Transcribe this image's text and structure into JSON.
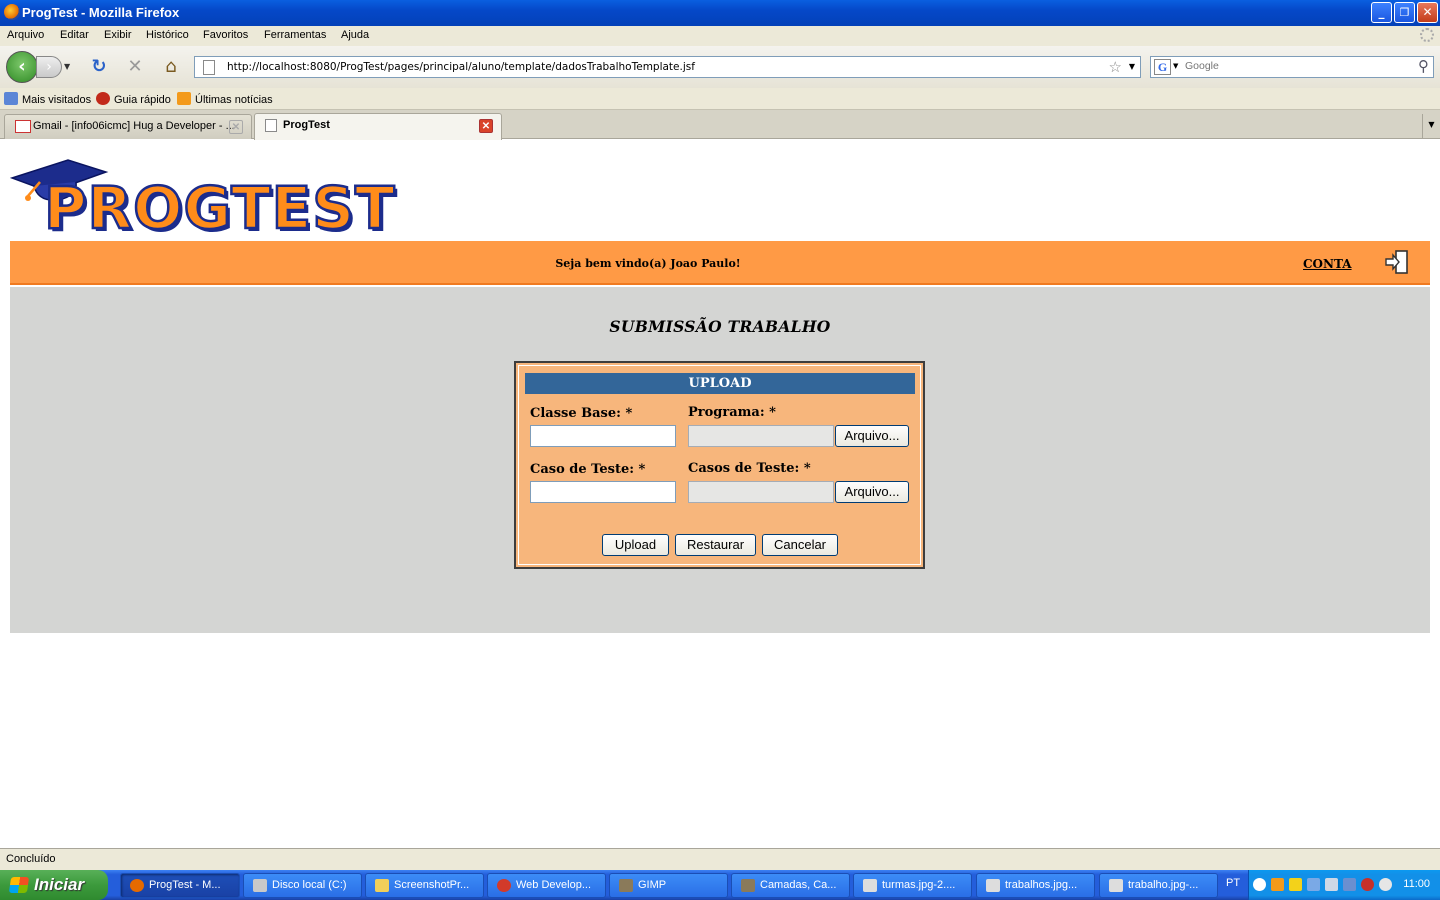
{
  "window": {
    "title": "ProgTest - Mozilla Firefox",
    "minimize": "_",
    "restore": "❐",
    "close": "✕"
  },
  "menu": {
    "items": [
      "Arquivo",
      "Editar",
      "Exibir",
      "Histórico",
      "Favoritos",
      "Ferramentas",
      "Ajuda"
    ]
  },
  "nav": {
    "url": "http://localhost:8080/ProgTest/pages/principal/aluno/template/dadosTrabalhoTemplate.jsf",
    "search_placeholder": "Google",
    "icons": [
      "back-icon",
      "forward-icon",
      "reload-icon",
      "stop-icon",
      "home-icon",
      "bookmark-star-icon",
      "search-icon"
    ]
  },
  "bookmarks": {
    "items": [
      "Mais visitados",
      "Guia rápido",
      "Últimas notícias"
    ]
  },
  "tabs": [
    {
      "label": "Gmail - [info06icmc] Hug a Developer - ...",
      "active": false
    },
    {
      "label": "ProgTest",
      "active": true
    }
  ],
  "page": {
    "logo_text": "PROGTEST",
    "welcome": "Seja bem vindo(a) Joao Paulo!",
    "conta_link": "CONTA",
    "title": "SUBMISSÃO TRABALHO",
    "form": {
      "header": "UPLOAD",
      "classe_base_label": "Classe Base:  *",
      "classe_base_value": "",
      "programa_label": "Programa:  *",
      "programa_value": "",
      "caso_teste_label": "Caso de Teste:  *",
      "caso_teste_value": "",
      "casos_teste_label": "Casos de Teste:  *",
      "casos_teste_value": "",
      "browse_label": "Arquivo...",
      "upload_button": "Upload",
      "reset_button": "Restaurar",
      "cancel_button": "Cancelar"
    },
    "colors": {
      "header_band": "#ff9a45",
      "main_area": "#d4d5d3",
      "panel": "#f7b67c",
      "panel_header": "#336699"
    }
  },
  "status": {
    "text": "Concluído"
  },
  "taskbar": {
    "start": "Iniciar",
    "tasks": [
      {
        "label": "ProgTest - M...",
        "active": true
      },
      {
        "label": "Disco local (C:)",
        "active": false
      },
      {
        "label": "ScreenshotPr...",
        "active": false
      },
      {
        "label": "Web Develop...",
        "active": false
      },
      {
        "label": "GIMP",
        "active": false
      },
      {
        "label": "Camadas, Ca...",
        "active": false
      },
      {
        "label": "turmas.jpg-2....",
        "active": false
      },
      {
        "label": "trabalhos.jpg...",
        "active": false
      },
      {
        "label": "trabalho.jpg-...",
        "active": false
      }
    ],
    "language": "PT",
    "clock": "11:00"
  }
}
